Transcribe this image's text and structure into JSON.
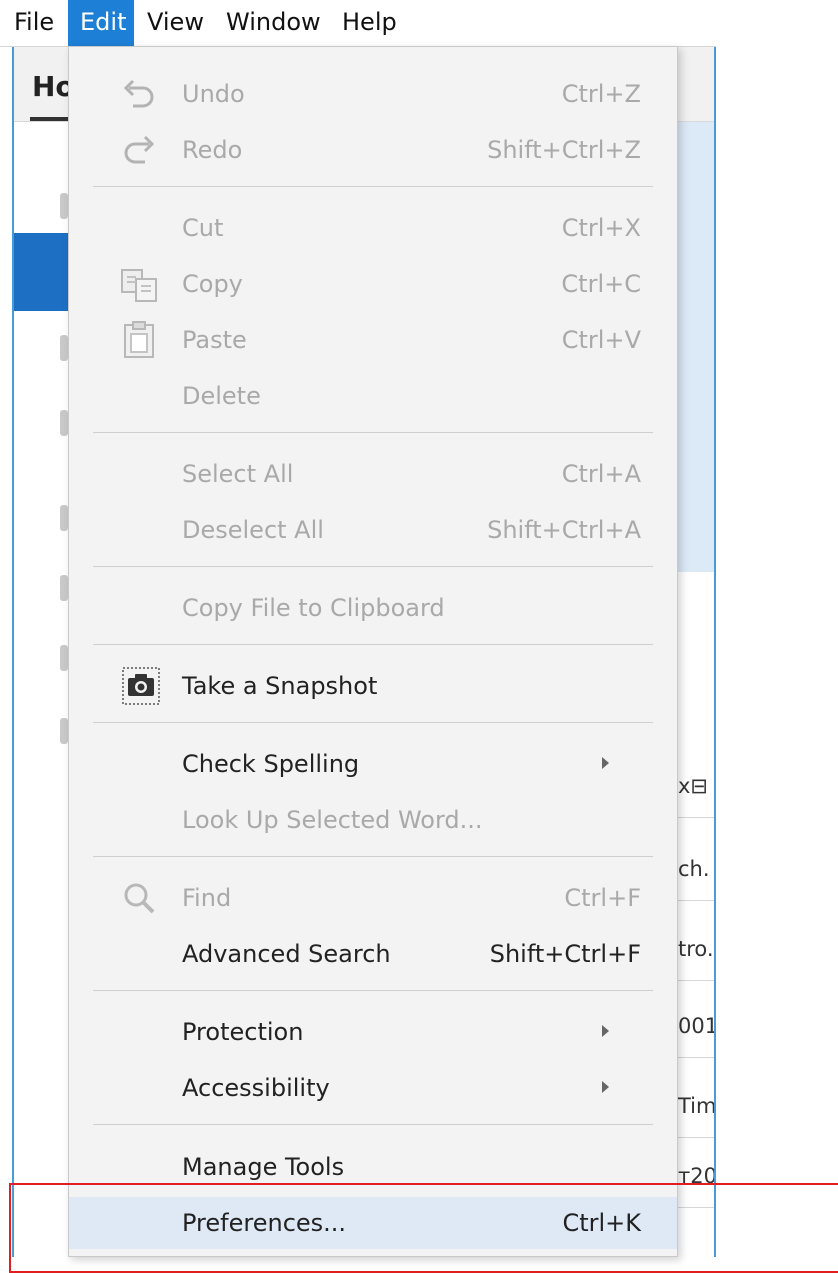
{
  "menubar": {
    "items": [
      {
        "label": "File"
      },
      {
        "label": "Edit"
      },
      {
        "label": "View"
      },
      {
        "label": "Window"
      },
      {
        "label": "Help"
      }
    ]
  },
  "background": {
    "home_tab": "Ho",
    "right_fragments": [
      "x⊟",
      "ch.",
      "tro.",
      "001",
      "Tim",
      "т20"
    ]
  },
  "edit_menu": {
    "undo": {
      "label": "Undo",
      "shortcut": "Ctrl+Z"
    },
    "redo": {
      "label": "Redo",
      "shortcut": "Shift+Ctrl+Z"
    },
    "cut": {
      "label": "Cut",
      "shortcut": "Ctrl+X"
    },
    "copy": {
      "label": "Copy",
      "shortcut": "Ctrl+C"
    },
    "paste": {
      "label": "Paste",
      "shortcut": "Ctrl+V"
    },
    "delete": {
      "label": "Delete"
    },
    "select_all": {
      "label": "Select All",
      "shortcut": "Ctrl+A"
    },
    "deselect_all": {
      "label": "Deselect All",
      "shortcut": "Shift+Ctrl+A"
    },
    "copy_file": {
      "label": "Copy File to Clipboard"
    },
    "snapshot": {
      "label": "Take a Snapshot"
    },
    "check_spelling": {
      "label": "Check Spelling"
    },
    "look_up": {
      "label": "Look Up Selected Word..."
    },
    "find": {
      "label": "Find",
      "shortcut": "Ctrl+F"
    },
    "advanced_search": {
      "label": "Advanced Search",
      "shortcut": "Shift+Ctrl+F"
    },
    "protection": {
      "label": "Protection"
    },
    "accessibility": {
      "label": "Accessibility"
    },
    "manage_tools": {
      "label": "Manage Tools"
    },
    "preferences": {
      "label": "Preferences...",
      "shortcut": "Ctrl+K"
    }
  },
  "colors": {
    "active_menu": "#1d7fd6",
    "highlight_box": "#e02020",
    "disabled_text": "#a9a9a9"
  }
}
